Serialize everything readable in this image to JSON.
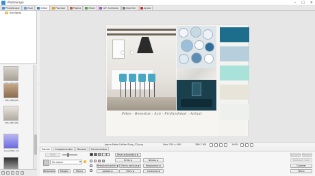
{
  "window": {
    "title": "PhotoScape",
    "controls": {
      "minimize": "–",
      "maximize": "□",
      "close": "✕"
    }
  },
  "tabs": [
    {
      "label": "PhotoScape",
      "icon": "photoscape-icon",
      "color": "#4a90d9",
      "active": false
    },
    {
      "label": "Visor",
      "icon": "viewer-icon",
      "color": "#5aa0e0",
      "active": false
    },
    {
      "label": "Editor",
      "icon": "editor-icon",
      "color": "#2f7fd0",
      "active": true
    },
    {
      "label": "Procesar",
      "icon": "batch-icon",
      "color": "#e0a020",
      "active": false
    },
    {
      "label": "Página",
      "icon": "page-icon",
      "color": "#c06030",
      "active": false
    },
    {
      "label": "Mezcl",
      "icon": "combine-icon",
      "color": "#50a050",
      "active": false
    },
    {
      "label": "GIF Animado",
      "icon": "gif-icon",
      "color": "#a050c0",
      "active": false
    },
    {
      "label": "Imprimir",
      "icon": "print-icon",
      "color": "#777777",
      "active": false
    },
    {
      "label": "Ayuda",
      "icon": "help-icon",
      "color": "#d03030",
      "active": false
    }
  ],
  "folder_tree": {
    "toggle": "–",
    "root": "Escritorio"
  },
  "thumbnails": [
    {
      "label": "IMG_3064.JPG",
      "colors": [
        "#d8d4cc",
        "#a8a094"
      ]
    },
    {
      "label": "IMG_3066.JPG",
      "colors": [
        "#c8a88a",
        "#8a6a4c"
      ]
    },
    {
      "label": "IMG_3067.JPG",
      "colors": [
        "#e8e4de",
        "#b0aaa0"
      ]
    },
    {
      "label": "Jaque Mate Cof",
      "colors": [
        "#b8b6f2",
        "#6d6be0"
      ]
    },
    {
      "label": "",
      "colors": [
        "#2e2e2e",
        "#b3b3b3"
      ]
    }
  ],
  "board": {
    "caption": "Pólvo - Bosestus - Azú - Profundidad - Actual",
    "swatches": [
      "#1d6e8c",
      "#b7cfdc",
      "#a8e2d9",
      "#e7e4da",
      "#eef0ee"
    ]
  },
  "status": {
    "filename": "Jaque Mate Coffee Shop_13.png",
    "dimensions": "Foto 700 x 490",
    "filesize": "386.7 KB",
    "zoom": "100%"
  },
  "bottom_tabs": [
    {
      "label": "Edición",
      "active": true
    },
    {
      "label": "Complementos",
      "active": false
    },
    {
      "label": "Recorte",
      "active": false
    },
    {
      "label": "Herramientas",
      "active": false
    }
  ],
  "panel": {
    "rotate_label": "Girar",
    "frame_value": "Sin marco",
    "round_label": "Redondeo",
    "margin_label": "Margen",
    "frame_label": "Marco",
    "auto_level": "Nivel automático",
    "backlight": "Retroiluminación",
    "film_effect": "Efecto película",
    "filter": "Filtro",
    "adjust": "Ajustes",
    "bright": "Brillo",
    "sharpen": "Nitidez",
    "sharpen2": "Resplandor",
    "contrast": "Contraluz",
    "undo": "Deshacer",
    "redo": "Rehacer",
    "undo_all": "Deshacer todo",
    "save": "Guardar",
    "menu": "Menú",
    "dropdown_arrow": "▼"
  }
}
